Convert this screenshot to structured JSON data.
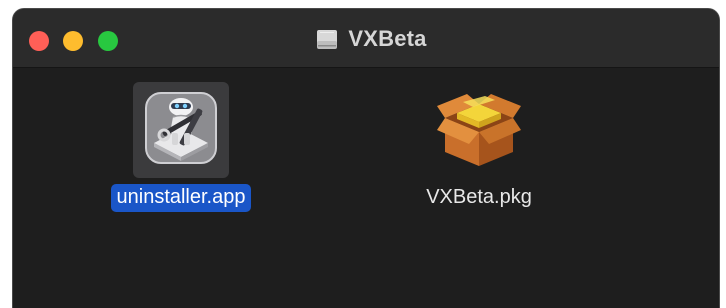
{
  "window": {
    "title": "VXBeta",
    "title_icon": "disk-image-icon"
  },
  "traffic_lights": {
    "close_color": "#ff5f57",
    "minimize_color": "#febc2e",
    "zoom_color": "#28c840"
  },
  "files": [
    {
      "name": "uninstaller.app",
      "icon": "automator-robot-icon",
      "selected": true
    },
    {
      "name": "VXBeta.pkg",
      "icon": "package-box-icon",
      "selected": false
    }
  ],
  "colors": {
    "selection": "#1a56c8",
    "background": "#1e1e1e"
  }
}
